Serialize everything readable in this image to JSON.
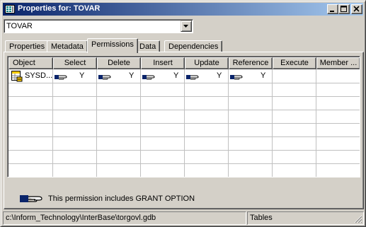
{
  "window": {
    "title": "Properties for: TOVAR",
    "buttons": [
      "minimize",
      "maximize",
      "close"
    ]
  },
  "object_selector": {
    "value": "TOVAR"
  },
  "tabs": [
    {
      "label": "Properties",
      "active": false
    },
    {
      "label": "Metadata",
      "active": false
    },
    {
      "label": "Permissions",
      "active": true
    },
    {
      "label": "Data",
      "active": false
    },
    {
      "label": "Dependencies",
      "active": false
    }
  ],
  "grid": {
    "columns": [
      "Object",
      "Select",
      "Delete",
      "Insert",
      "Update",
      "Reference",
      "Execute",
      "Member ..."
    ],
    "rows": [
      {
        "object": "SYSD...",
        "select": "Y",
        "delete": "Y",
        "insert": "Y",
        "update": "Y",
        "reference": "Y",
        "execute": "",
        "member": ""
      }
    ]
  },
  "legend": {
    "icon": "grant-option-hand-icon",
    "text": "This permission includes GRANT OPTION"
  },
  "statusbar": {
    "path": "c:\\Inform_Technology\\InterBase\\torgovl.gdb",
    "section": "Tables"
  },
  "colors": {
    "titlebar_start": "#0a246a",
    "titlebar_end": "#a6caf0",
    "face": "#d4d0c8",
    "hand_cuff": "#0a246a"
  }
}
